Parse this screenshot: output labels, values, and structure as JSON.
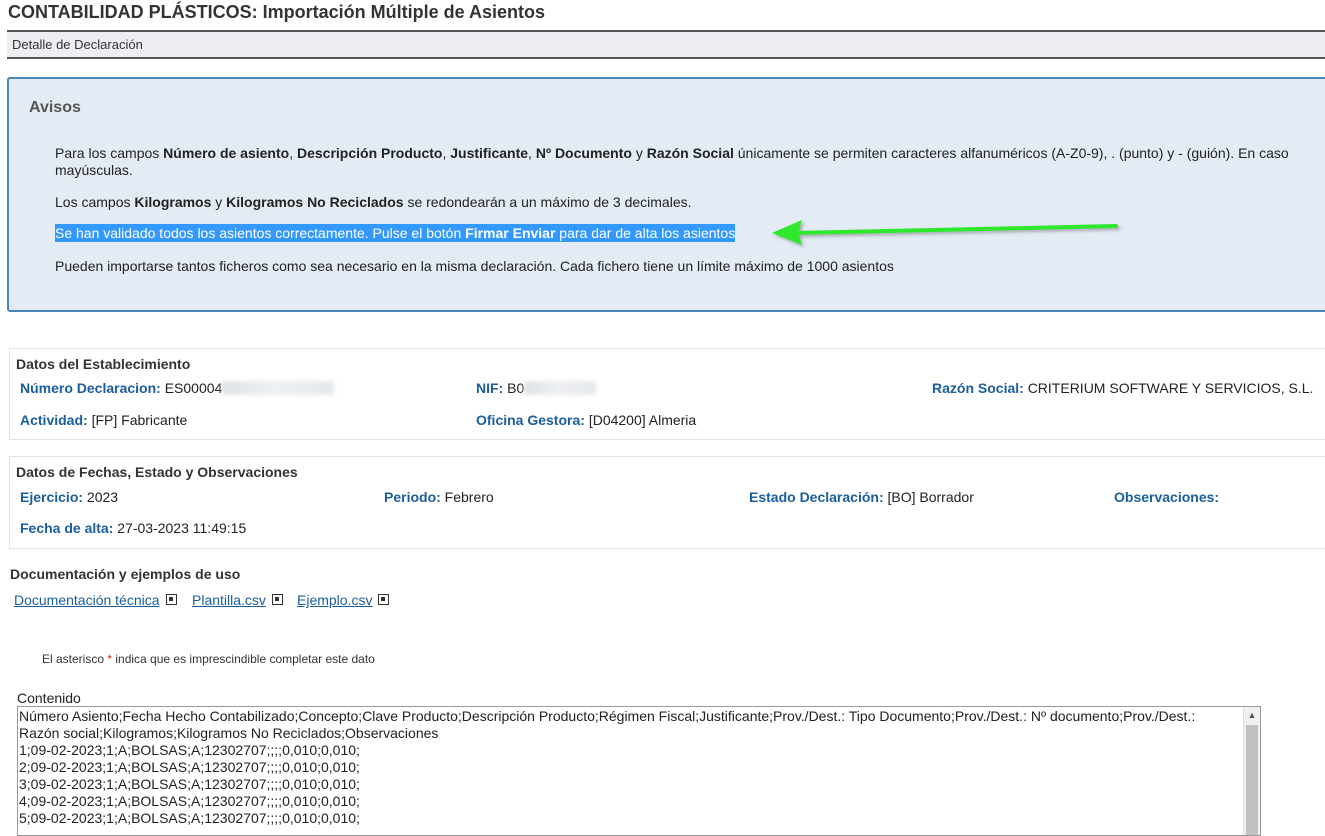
{
  "header": {
    "title": "CONTABILIDAD PLÁSTICOS: Importación Múltiple de Asientos",
    "subtitle": "Detalle de Declaración"
  },
  "avisos": {
    "title": "Avisos",
    "p1": {
      "t1": "Para los campos ",
      "b1": "Número de asiento",
      "t2": ", ",
      "b2": "Descripción Producto",
      "t3": ", ",
      "b3": "Justificante",
      "t4": ", ",
      "b4": "Nº Documento",
      "t5": " y ",
      "b5": "Razón Social",
      "t6": " únicamente se permiten caracteres alfanuméricos (A-Z0-9), . (punto) y - (guión). En caso",
      "line2": "mayúsculas."
    },
    "p2": {
      "t1": "Los campos ",
      "b1": "Kilogramos",
      "t2": " y ",
      "b2": "Kilogramos No Reciclados",
      "t3": " se redondearán a un máximo de 3 decimales."
    },
    "p3": {
      "t1": "Se han validado todos los asientos correctamente. Pulse el botón ",
      "b1": "Firmar Enviar",
      "t2": " para dar de alta los asientos"
    },
    "p4": "Pueden importarse tantos ficheros como sea necesario en la misma declaración. Cada fichero tiene un límite máximo de 1000 asientos",
    "arrow_color": "#2ee82e"
  },
  "establecimiento": {
    "title": "Datos del Establecimiento",
    "numero_label": "Número Declaracion:",
    "numero_value": "ES00004",
    "nif_label": "NIF:",
    "nif_value": "B0",
    "razon_label": "Razón Social:",
    "razon_value": "CRITERIUM SOFTWARE Y SERVICIOS, S.L.",
    "actividad_label": "Actividad:",
    "actividad_value": "[FP] Fabricante",
    "oficina_label": "Oficina Gestora:",
    "oficina_value": "[D04200] Almeria"
  },
  "fechas": {
    "title": "Datos de Fechas, Estado y Observaciones",
    "ejercicio_label": "Ejercicio:",
    "ejercicio_value": "2023",
    "periodo_label": "Periodo:",
    "periodo_value": "Febrero",
    "estado_label": "Estado Declaración:",
    "estado_value": "[BO] Borrador",
    "observaciones_label": "Observaciones:",
    "fecha_alta_label": "Fecha de alta:",
    "fecha_alta_value": "27-03-2023 11:49:15"
  },
  "documentacion": {
    "title": "Documentación y ejemplos de uso",
    "links": [
      "Documentación técnica",
      "Plantilla.csv",
      "Ejemplo.csv"
    ]
  },
  "form": {
    "note_prefix": "El asterisco ",
    "note_star": "*",
    "note_suffix": " indica que es imprescindible completar este dato",
    "content_label": "Contenido",
    "content_lines": [
      "Número Asiento;Fecha Hecho Contabilizado;Concepto;Clave Producto;Descripción Producto;Régimen Fiscal;Justificante;Prov./Dest.: Tipo Documento;Prov./Dest.: Nº documento;Prov./Dest.:",
      "Razón social;Kilogramos;Kilogramos No Reciclados;Observaciones",
      "1;09-02-2023;1;A;BOLSAS;A;12302707;;;;0,010;0,010;",
      "2;09-02-2023;1;A;BOLSAS;A;12302707;;;;0,010;0,010;",
      "3;09-02-2023;1;A;BOLSAS;A;12302707;;;;0,010;0,010;",
      "4;09-02-2023;1;A;BOLSAS;A;12302707;;;;0,010;0,010;",
      "5;09-02-2023;1;A;BOLSAS;A;12302707;;;;0,010;0,010;"
    ]
  }
}
